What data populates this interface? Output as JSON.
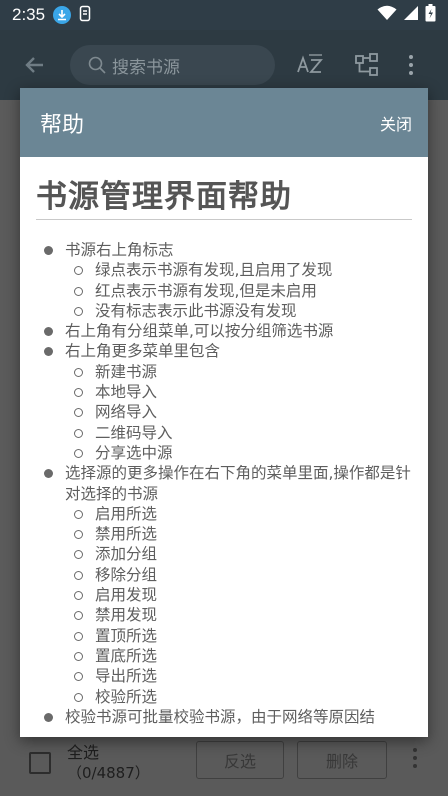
{
  "status": {
    "time": "2:35"
  },
  "toolbar": {
    "search_placeholder": "搜索书源",
    "sort_icon": "sort-az-icon",
    "group_icon": "group-icon"
  },
  "dialog": {
    "title": "帮助",
    "close_label": "关闭",
    "heading": "书源管理界面帮助",
    "sections": [
      {
        "text": "书源右上角标志",
        "items": [
          "绿点表示书源有发现,且启用了发现",
          "红点表示书源有发现,但是未启用",
          "没有标志表示此书源没有发现"
        ]
      },
      {
        "text": "右上角有分组菜单,可以按分组筛选书源",
        "items": []
      },
      {
        "text": "右上角更多菜单里包含",
        "items": [
          "新建书源",
          "本地导入",
          "网络导入",
          "二维码导入",
          "分享选中源"
        ]
      },
      {
        "text": "选择源的更多操作在右下角的菜单里面,操作都是针对选择的书源",
        "items": [
          "启用所选",
          "禁用所选",
          "添加分组",
          "移除分组",
          "启用发现",
          "禁用发现",
          "置顶所选",
          "置底所选",
          "导出所选",
          "校验所选"
        ]
      },
      {
        "text": "校验书源可批量校验书源，由于网络等原因结",
        "items": []
      }
    ]
  },
  "bottom": {
    "select_all": "全选",
    "count": "（0/4887）",
    "invert_label": "反选",
    "delete_label": "删除"
  },
  "colors": {
    "dialog_header": "#6b8695",
    "status_bar": "#2f3d47"
  }
}
